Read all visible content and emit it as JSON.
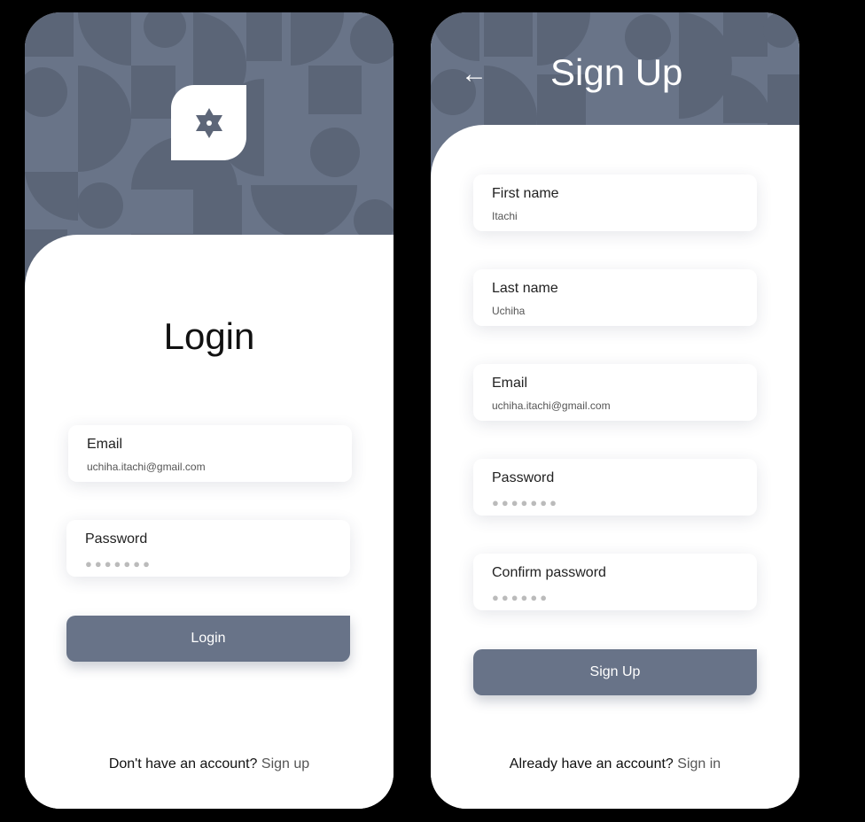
{
  "login": {
    "title": "Login",
    "email_label": "Email",
    "email_value": "uchiha.itachi@gmail.com",
    "password_label": "Password",
    "password_value": "●●●●●●●",
    "button_label": "Login",
    "footer_text": "Don't have an account?",
    "footer_link": "Sign up"
  },
  "signup": {
    "title": "Sign Up",
    "back_glyph": "←",
    "first_name_label": "First name",
    "first_name_value": "Itachi",
    "last_name_label": "Last name",
    "last_name_value": "Uchiha",
    "email_label": "Email",
    "email_value": "uchiha.itachi@gmail.com",
    "password_label": "Password",
    "password_value": "●●●●●●●",
    "confirm_label": "Confirm password",
    "confirm_value": "●●●●●●",
    "button_label": "Sign Up",
    "footer_text": "Already have an account?",
    "footer_link": "Sign in"
  },
  "colors": {
    "pattern_bg": "#697488",
    "pattern_shape": "#5b6577",
    "button": "#687388"
  },
  "icons": [
    "star-of-david-icon",
    "back-arrow-icon"
  ]
}
